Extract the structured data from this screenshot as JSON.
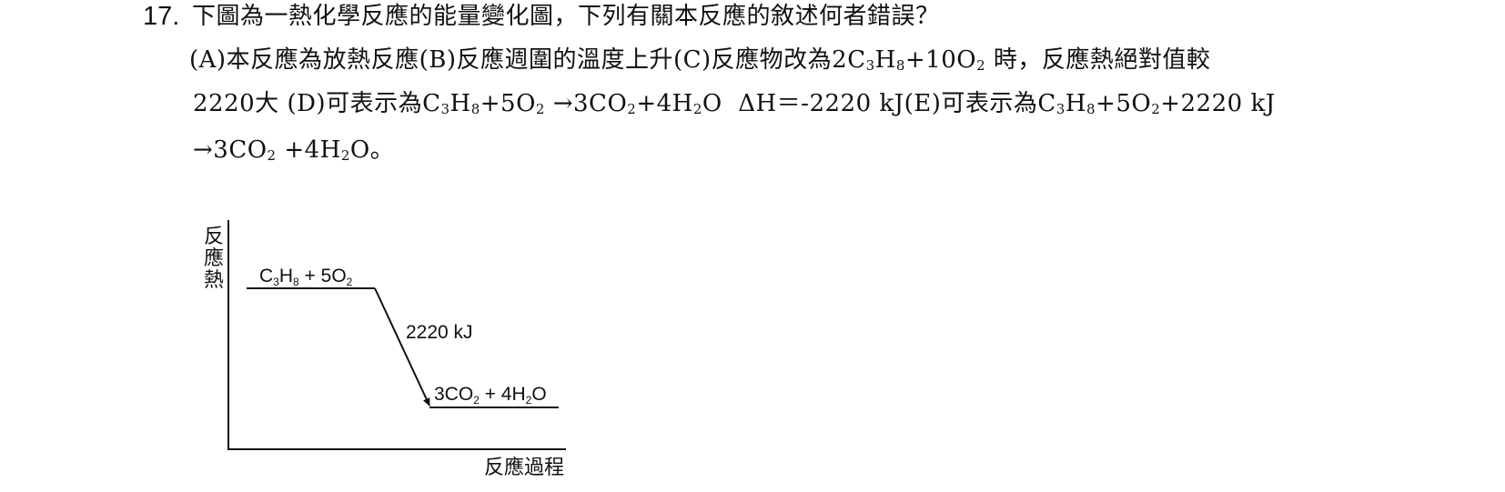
{
  "question": {
    "number": "17.",
    "stem": "下圖為一熱化學反應的能量變化圖，下列有關本反應的敘述何者錯誤？",
    "options": {
      "A": "(A)本反應為放熱反應",
      "B": "(B)反應週圍的溫度上升",
      "C_pre": "(C)反應物改為2C",
      "C_h": "H",
      "C_o": "+10O",
      "C_post": "時，反應熱絕對值較",
      "C_line2": "2220大",
      "D_pre": "(D)可表示為C",
      "D_h": "H",
      "D_mid": "+5O",
      "D_arrow": "→3CO",
      "D_water": "+4H",
      "D_tail": "O  ΔH＝-2220 kJ",
      "E_pre": "(E)可表示為C",
      "E_h": "H",
      "E_mid": "+5O",
      "E_heat": "+2220 kJ",
      "E_line2_arrow": "→3CO",
      "E_line2_water": "+4H",
      "E_line2_tail": "O。"
    },
    "subscripts": {
      "s2": "2",
      "s3": "3",
      "s8": "8"
    }
  },
  "diagram": {
    "y_axis_label": [
      "反",
      "應",
      "熱"
    ],
    "x_axis_label": "反應過程",
    "reactant_label": {
      "c": "C",
      "h": "H",
      "mid": " + 5O",
      "s3": "3",
      "s8": "8",
      "s2": "2"
    },
    "product_label": {
      "pre": "3CO",
      "s2": "2",
      "mid": " + 4H",
      "s2b": "2",
      "tail": "O"
    },
    "heat_label": "2220 kJ"
  }
}
